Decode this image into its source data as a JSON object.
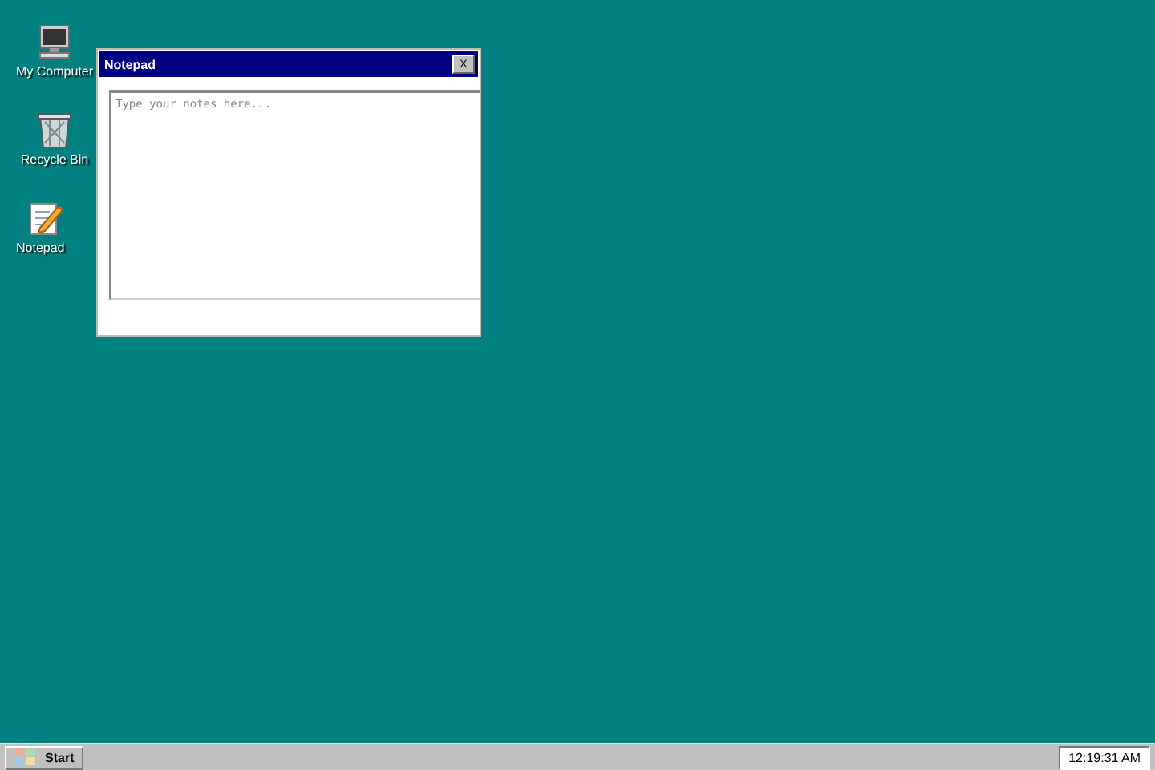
{
  "desktop_icons": [
    {
      "kind": "computer",
      "label": "My Computer"
    },
    {
      "kind": "recycle",
      "label": "Recycle Bin"
    },
    {
      "kind": "notepad",
      "label": "Notepad"
    }
  ],
  "window": {
    "title": "Notepad",
    "close": "X",
    "editor": {
      "placeholder": "Type your notes here..."
    }
  },
  "taskbar": {
    "start": "Start",
    "clock": "12:19:31 AM"
  }
}
